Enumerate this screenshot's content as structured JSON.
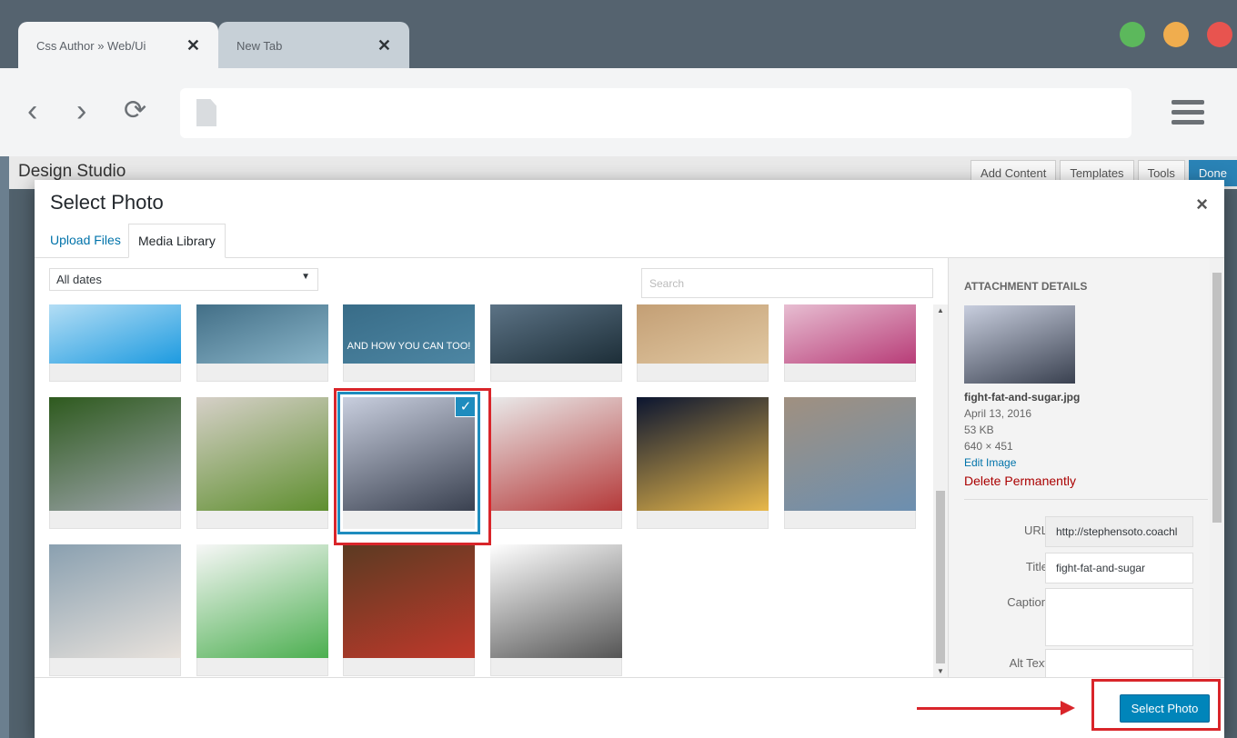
{
  "browser": {
    "tabs": [
      {
        "title": "Css Author » Web/Ui",
        "close": "✕"
      },
      {
        "title": "New Tab",
        "close": "✕"
      }
    ],
    "window_controls": {
      "green": "#5cb85c",
      "yellow": "#f0ad4e",
      "red": "#e8544f"
    },
    "nav": {
      "back": "‹",
      "forward": "›",
      "reload": "⟳"
    },
    "address_value": ""
  },
  "page": {
    "title": "Design Studio",
    "tools": [
      "Add Content",
      "Templates",
      "Tools",
      "Done"
    ]
  },
  "modal": {
    "title": "Select Photo",
    "close": "×",
    "tabs": {
      "upload": "Upload Files",
      "library": "Media Library"
    },
    "date_filter": "All dates",
    "search_placeholder": "Search",
    "selected_index": 8,
    "thumbnails": [
      {
        "name": "checkmark-logo",
        "colors": [
          "#ffffff",
          "#1e9be0"
        ]
      },
      {
        "name": "runner-feet",
        "colors": [
          "#1f4c66",
          "#89b4c8"
        ]
      },
      {
        "name": "and-how-you-can-too",
        "colors": [
          "#2e5f7a",
          "#4d86a3"
        ],
        "caption": "AND HOW YOU CAN TOO!"
      },
      {
        "name": "mountain-landscape",
        "colors": [
          "#7c96ad",
          "#1d2e38"
        ]
      },
      {
        "name": "classical-painting",
        "colors": [
          "#b48a5e",
          "#e1c8a2"
        ]
      },
      {
        "name": "knot-logo",
        "colors": [
          "#ffffff",
          "#b83d78"
        ]
      },
      {
        "name": "person-lying-grass",
        "colors": [
          "#2e5a1e",
          "#9fa5ad"
        ]
      },
      {
        "name": "salad-tray",
        "colors": [
          "#d6d0c8",
          "#5f8f2f"
        ]
      },
      {
        "name": "fight-fat-and-sugar",
        "colors": [
          "#c8cede",
          "#3a4150"
        ]
      },
      {
        "name": "couple-kissing",
        "colors": [
          "#e9e9e9",
          "#b53a3a"
        ]
      },
      {
        "name": "night-earth-lights",
        "colors": [
          "#0b1530",
          "#e8b84a"
        ]
      },
      {
        "name": "woman-jogging-beach",
        "colors": [
          "#a09080",
          "#6c8fb0"
        ]
      },
      {
        "name": "people-meeting",
        "colors": [
          "#8aa0b0",
          "#e8e2dc"
        ]
      },
      {
        "name": "brain-coloring",
        "colors": [
          "#f7f7f7",
          "#4caf50"
        ]
      },
      {
        "name": "vegetables-table",
        "colors": [
          "#5b3a22",
          "#c0392b"
        ]
      },
      {
        "name": "image-placeholder",
        "colors": [
          "#ffffff",
          "#555555"
        ]
      }
    ],
    "sidebar": {
      "heading": "ATTACHMENT DETAILS",
      "filename": "fight-fat-and-sugar.jpg",
      "date": "April 13, 2016",
      "size": "53 KB",
      "dimensions": "640 × 451",
      "edit_link": "Edit Image",
      "delete_link": "Delete Permanently",
      "fields": [
        {
          "label": "URL",
          "value": "http://stephensoto.coachl"
        },
        {
          "label": "Title",
          "value": "fight-fat-and-sugar"
        },
        {
          "label": "Caption",
          "value": ""
        },
        {
          "label": "Alt Text",
          "value": ""
        }
      ]
    },
    "select_button": "Select Photo"
  }
}
